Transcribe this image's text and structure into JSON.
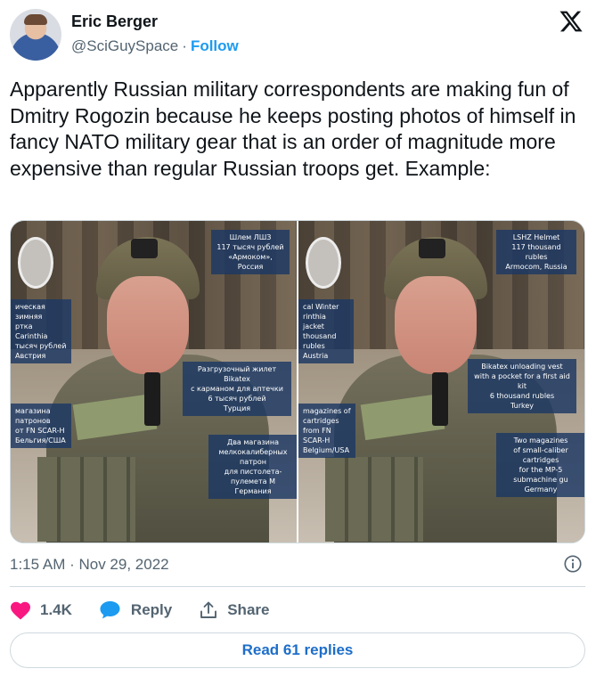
{
  "author": {
    "name": "Eric Berger",
    "handle": "@SciGuySpace",
    "separator": "·",
    "follow_label": "Follow",
    "avatar_icon": "avatar-photo"
  },
  "brand_icon": "x-logo-icon",
  "tweet": {
    "text": "Apparently Russian military correspondents are making fun of Dmitry Rogozin because he keeps posting photos of himself in fancy NATO military gear that is an order of magnitude more expensive than regular Russian troops get. Example:"
  },
  "media": {
    "left_photo_labels": {
      "helmet": "Шлем ЛШЗ\n117 тысяч рублей\n«Армоком», Россия",
      "jacket": "ическая зимняя\nртка Carinthia\nтысяч рублей\nАвстрия",
      "vest": "Разгрузочный жилет Bikatex\nс карманом для аптечки\n6 тысяч рублей\nТурция",
      "scar_mags": "магазина патронов\nот FN SCAR-H\nБельгия/США",
      "mp5_mags": "Два магазина\nмелкокалиберных патрон\nдля пистолета-пулемета М\nГермания"
    },
    "right_photo_labels": {
      "helmet": "LSHZ Helmet\n117 thousand rubles\nArmocom, Russia",
      "jacket": "cal Winter\nrinthia jacket\nthousand rubles\nAustria",
      "vest": "Bikatex unloading vest\nwith a pocket for a first aid kit\n6 thousand rubles\nTurkey",
      "scar_mags": "magazines of cartridges\nfrom FN SCAR-H\nBelgium/USA",
      "mp5_mags": "Two magazines\nof small-caliber cartridges\nfor the MP-5 submachine gu\nGermany"
    }
  },
  "meta": {
    "timestamp": "1:15 AM · Nov 29, 2022"
  },
  "actions": {
    "like_count": "1.4K",
    "reply_label": "Reply",
    "share_label": "Share",
    "like_color": "#f91880",
    "reply_color": "#1d9bf0"
  },
  "read_replies_label": "Read 61 replies",
  "colors": {
    "text": "#0f1419",
    "secondary": "#536471",
    "accent": "#1d9bf0",
    "border": "#cfd9de"
  }
}
